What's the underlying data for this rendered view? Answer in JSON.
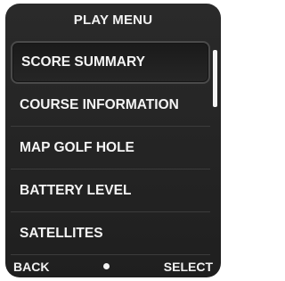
{
  "header": {
    "title": "PLAY MENU"
  },
  "menu": {
    "items": [
      {
        "label": "SCORE SUMMARY",
        "selected": true
      },
      {
        "label": "COURSE INFORMATION",
        "selected": false
      },
      {
        "label": "MAP GOLF HOLE",
        "selected": false
      },
      {
        "label": "BATTERY LEVEL",
        "selected": false
      },
      {
        "label": "SATELLITES",
        "selected": false
      }
    ]
  },
  "footer": {
    "back_label": "BACK",
    "select_label": "SELECT",
    "center_icon": "dot-icon"
  },
  "colors": {
    "background": "#222222",
    "text": "#f4f4f4",
    "divider": "#3c3c3c",
    "selection_border": "#4a4a4a"
  }
}
